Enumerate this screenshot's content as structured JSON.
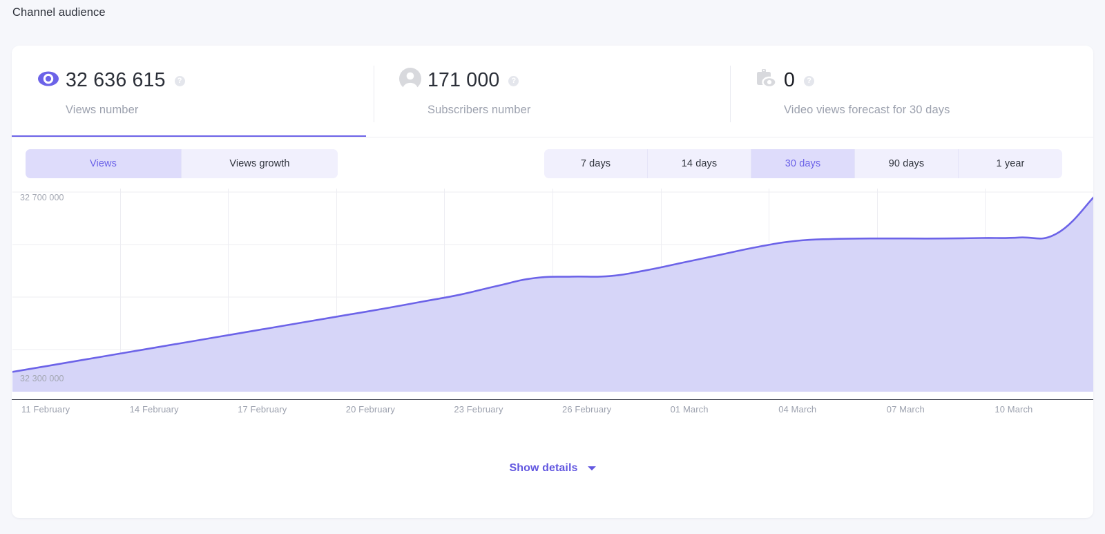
{
  "page": {
    "title": "Channel audience"
  },
  "stats": [
    {
      "icon": "eye-icon",
      "value": "32 636 615",
      "label": "Views number",
      "help": "?",
      "active": true
    },
    {
      "icon": "person-icon",
      "value": "171 000",
      "label": "Subscribers number",
      "help": "?",
      "active": false
    },
    {
      "icon": "video-views-forecast-icon",
      "value": "0",
      "label": "Video views forecast for 30 days",
      "help": "?",
      "active": false
    }
  ],
  "metric_toggle": {
    "options": [
      "Views",
      "Views growth"
    ],
    "selected": "Views"
  },
  "range_toggle": {
    "options": [
      "7 days",
      "14 days",
      "30 days",
      "90 days",
      "1 year"
    ],
    "selected": "30 days"
  },
  "footer": {
    "show_details_label": "Show details",
    "caret_icon": "chevron-down-icon"
  },
  "colors": {
    "accent": "#6c63e8",
    "accent_text": "#6257e0",
    "area_fill": "#d6d5f8",
    "segment_bg": "#f1f0fd",
    "segment_active_bg": "#dedcfb",
    "page_bg": "#f6f7fb",
    "card_bg": "#ffffff",
    "muted_text": "#9ca1ae"
  },
  "chart_data": {
    "type": "area",
    "title": "",
    "xlabel": "",
    "ylabel": "",
    "grid": true,
    "legend": "none",
    "ylim": [
      32300000,
      32700000
    ],
    "y_ticks": [
      "32 300 000",
      "32 700 000"
    ],
    "x_tick_labels": [
      "11 February",
      "14 February",
      "17 February",
      "20 February",
      "23 February",
      "26 February",
      "01 March",
      "04 March",
      "07 March",
      "10 March"
    ],
    "x": [
      "11 February",
      "12 February",
      "13 February",
      "14 February",
      "15 February",
      "16 February",
      "17 February",
      "18 February",
      "19 February",
      "20 February",
      "21 February",
      "22 February",
      "23 February",
      "24 February",
      "25 February",
      "26 February",
      "27 February",
      "28 February",
      "01 March",
      "02 March",
      "03 March",
      "04 March",
      "05 March",
      "06 March",
      "07 March",
      "08 March",
      "09 March",
      "10 March",
      "11 March",
      "12 March"
    ],
    "series": [
      {
        "name": "Views",
        "values": [
          32332000,
          32345000,
          32358000,
          32371000,
          32384000,
          32397000,
          32410000,
          32423000,
          32436000,
          32449000,
          32462000,
          32476000,
          32490000,
          32508000,
          32524000,
          32527000,
          32528000,
          32540000,
          32556000,
          32572000,
          32588000,
          32600000,
          32604000,
          32605000,
          32605000,
          32605000,
          32606000,
          32607000,
          32615000,
          32690000
        ]
      }
    ]
  }
}
